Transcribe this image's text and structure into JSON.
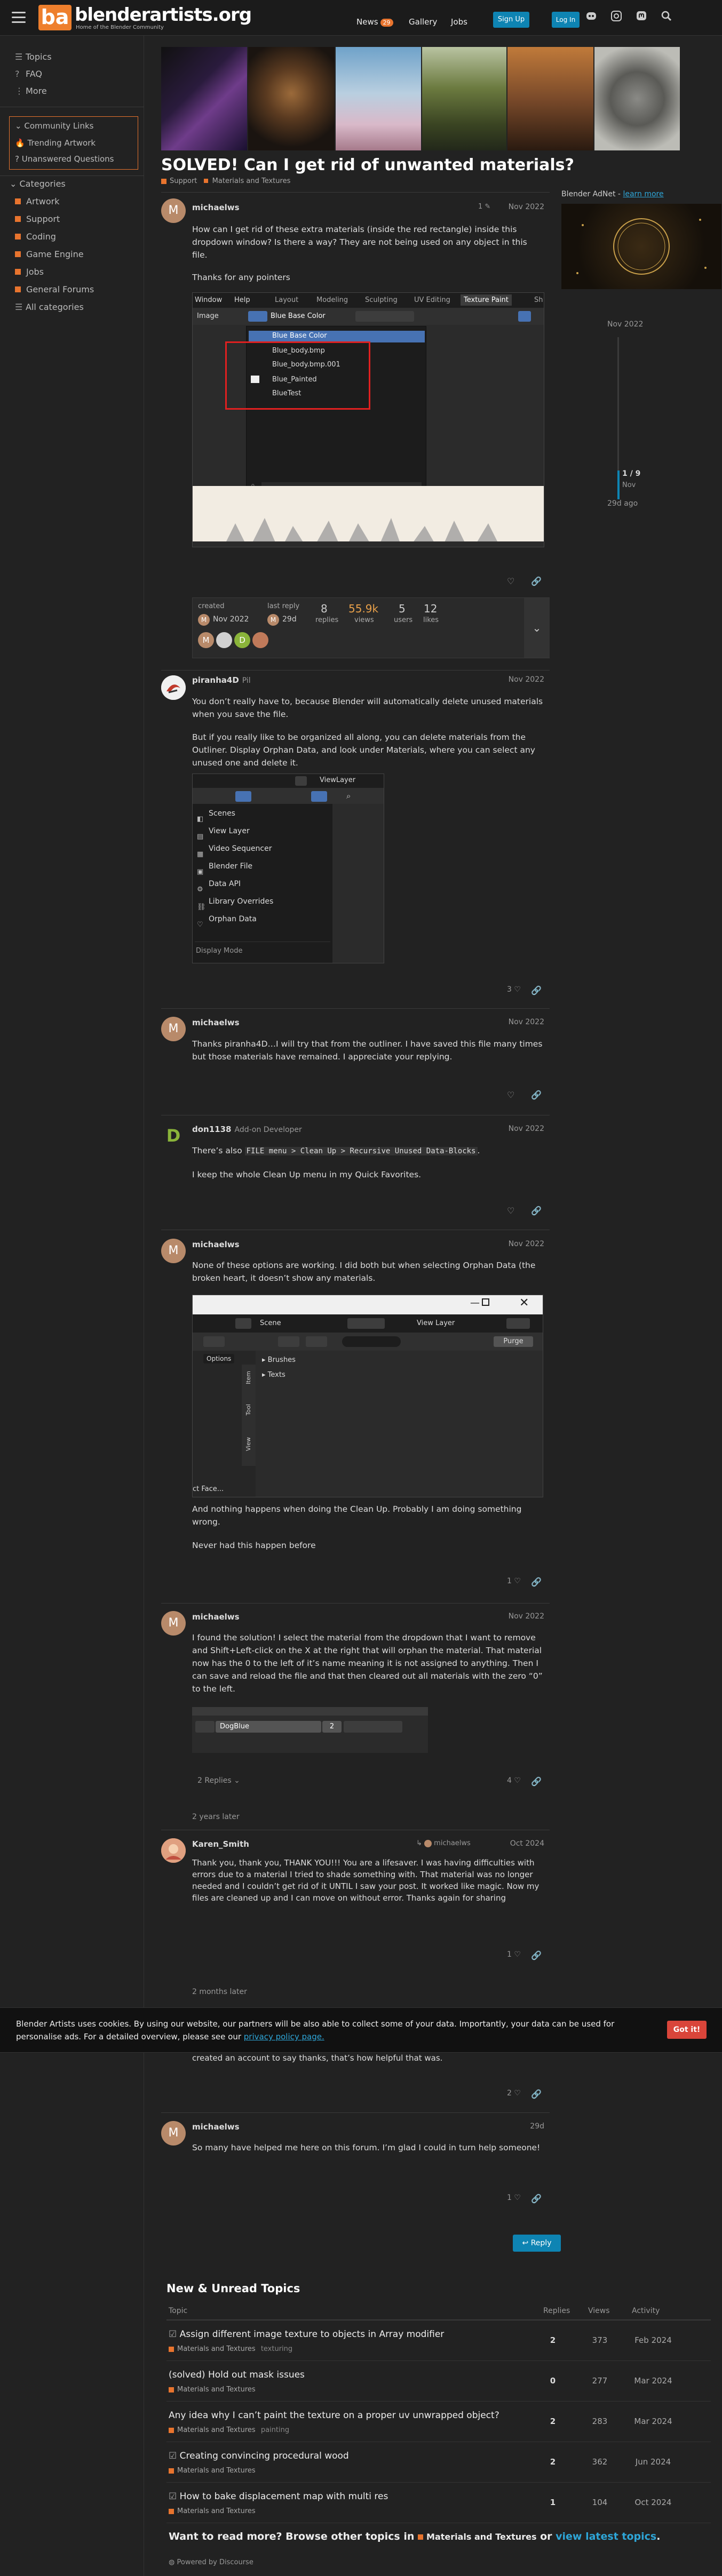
{
  "header": {
    "logo_letters": "ba",
    "logo_text": "blenderartists.org",
    "logo_sub": "Home of the Blender Community",
    "nav": {
      "news": "News",
      "news_badge": "29",
      "gallery": "Gallery",
      "jobs": "Jobs"
    },
    "signup": "Sign Up",
    "login": "Log In"
  },
  "sidebar": {
    "top": [
      "Topics",
      "FAQ",
      "More"
    ],
    "community": {
      "title": "Community Links",
      "items": [
        "Trending Artwork",
        "Unanswered Questions"
      ]
    },
    "categories_title": "Categories",
    "categories": [
      {
        "label": "Artwork",
        "color": "#e8742e"
      },
      {
        "label": "Support",
        "color": "#e8742e"
      },
      {
        "label": "Coding",
        "color": "#e8742e"
      },
      {
        "label": "Game Engine",
        "color": "#e8742e"
      },
      {
        "label": "Jobs",
        "color": "#e8742e"
      },
      {
        "label": "General Forums",
        "color": "#e8742e"
      }
    ],
    "all_categories": "All categories"
  },
  "topic": {
    "title": "SOLVED! Can I get rid of unwanted materials?",
    "crumb_parent": "Support",
    "crumb_child": "Materials and Textures"
  },
  "posts": [
    {
      "user": "michaelws",
      "date": "Nov 2022",
      "edit_count": "1",
      "p1": "How can I get rid of these extra materials (inside the red rectangle) inside this dropdown window? Is there a way? They are not being used on any object in this file.",
      "p2": "Thanks for any pointers"
    },
    {
      "user": "piranha4D",
      "user_title": "Pil",
      "date": "Nov 2022",
      "p1": "You don’t really have to, because Blender will automatically delete unused materials when you save the file.",
      "p2": "But if you really like to be organized all along, you can delete materials from the Outliner. Display Orphan Data, and look under Materials, where you can select any unused one and delete it.",
      "likes": "3"
    },
    {
      "user": "michaelws",
      "date": "Nov 2022",
      "p1": "Thanks piranha4D…I will try that from the outliner. I have saved this file many times but those materials have remained. I appreciate your replying."
    },
    {
      "user": "don1138",
      "user_title": "Add-on Developer",
      "date": "Nov 2022",
      "p1a": "There’s also ",
      "code": "FILE menu > Clean Up > Recursive Unused Data-Blocks",
      "p1b": ".",
      "p2": "I keep the whole Clean Up menu in my Quick Favorites."
    },
    {
      "user": "michaelws",
      "date": "Nov 2022",
      "p1": "None of these options are working. I did both but when selecting Orphan Data (the broken heart, it doesn’t show any materials.",
      "p2": "And nothing happens when doing the Clean Up. Probably I am doing something wrong.",
      "p3": "Never had this happen before",
      "likes": "1"
    },
    {
      "user": "michaelws",
      "date": "Nov 2022",
      "p1": "I found the solution! I select the material from the dropdown that I want to remove and Shift+Left-click on the X at the right that will orphan the material. That material now has the 0 to the left of it’s name meaning it is not assigned to anything. Then I can save and reload the file and that then cleared out all materials with the zero “0” to the left.",
      "likes": "4",
      "replies": "2 Replies"
    },
    {
      "user": "Karen_Smith",
      "reply_to": "michaelws",
      "date": "Oct 2024",
      "p1": "Thank you, thank you, THANK YOU!!! You are a lifesaver. I was having difficulties with errors due to a material I tried to shade something with. That material was no longer needed and I couldn’t get rid of it UNTIL I saw your post. It worked like magic. Now my files are cleaned up and I can move on without error. Thanks again for sharing",
      "likes": "1"
    },
    {
      "tail_text": "created an account to say thanks, that’s how helpful that was.",
      "likes": "2"
    },
    {
      "user": "michaelws",
      "date": "29d",
      "p1": "So many have helped me here on this forum. I’m glad I could in turn help someone!",
      "likes": "1"
    }
  ],
  "time_gaps": [
    "2 years later",
    "2 months later"
  ],
  "topic_map": {
    "created_lbl": "created",
    "created": "Nov 2022",
    "last_lbl": "last reply",
    "last": "29d",
    "replies": "8",
    "replies_lbl": "replies",
    "views": "55.9k",
    "views_lbl": "views",
    "users": "5",
    "users_lbl": "users",
    "likes": "12",
    "likes_lbl": "likes"
  },
  "screenshot1": {
    "menu": [
      "Window",
      "Help"
    ],
    "tabs": [
      "Layout",
      "Modeling",
      "Sculpting",
      "UV Editing",
      "Texture Paint",
      "Sh"
    ],
    "image_lbl": "Image",
    "field": "Blue Base Color",
    "items": [
      "Blue Base Color",
      "Blue_body.bmp",
      "Blue_body.bmp.001",
      "Blue_Painted",
      "BlueTest"
    ]
  },
  "screenshot2": {
    "header": "ViewLayer",
    "items": [
      "Scenes",
      "View Layer",
      "Video Sequencer",
      "Blender File",
      "Data API",
      "Library Overrides",
      "Orphan Data"
    ],
    "footer": "Display Mode"
  },
  "screenshot3": {
    "scene": "Scene",
    "view_layer": "View Layer",
    "options": "Options",
    "purge": "Purge",
    "tree": [
      "Brushes",
      "Texts"
    ],
    "vtabs": [
      "Item",
      "Tool",
      "View"
    ],
    "cut": "ct Face..."
  },
  "screenshot4": {
    "name": "DogBlue",
    "count": "2"
  },
  "right_rail": {
    "adnet": "Blender AdNet",
    "learn": "learn more",
    "timeline_top": "Nov 2022",
    "pos": "1 / 9",
    "pos_date": "Nov",
    "ago": "29d ago"
  },
  "reply_btn": "Reply",
  "suggested": {
    "title": "New & Unread Topics",
    "cols": [
      "Topic",
      "Replies",
      "Views",
      "Activity"
    ],
    "rows": [
      {
        "title": "Assign different image texture to objects in Array modifier",
        "cat": "Materials and Textures",
        "tag": "texturing",
        "replies": "2",
        "views": "373",
        "activity": "Feb 2024"
      },
      {
        "title": "(solved) Hold out mask issues",
        "cat": "Materials and Textures",
        "tag": "",
        "replies": "0",
        "views": "277",
        "activity": "Mar 2024"
      },
      {
        "title": "Any idea why I can’t paint the texture on a proper uv unwrapped object?",
        "cat": "Materials and Textures",
        "tag": "painting",
        "replies": "2",
        "views": "283",
        "activity": "Mar 2024"
      },
      {
        "title": "Creating convincing procedural wood",
        "cat": "Materials and Textures",
        "tag": "",
        "replies": "2",
        "views": "362",
        "activity": "Jun 2024"
      },
      {
        "title": "How to bake displacement map with multi res",
        "cat": "Materials and Textures",
        "tag": "",
        "replies": "1",
        "views": "104",
        "activity": "Oct 2024"
      }
    ],
    "more_a": "Want to read more? Browse other topics in ",
    "more_cat": "Materials and Textures",
    "more_or": " or ",
    "more_link": "view latest topics",
    "more_end": "."
  },
  "powered": "Powered by Discourse",
  "cookie": {
    "text": "Blender Artists uses cookies. By using our website, our partners will be also able to collect some of your data. Importantly, your data can be used for personalise ads. For a detailed overview, please see our ",
    "link": "privacy policy page.",
    "btn": "Got it!"
  },
  "colors": {
    "accent": "#e8742e",
    "link": "#2ea6d8",
    "bg": "#222222"
  }
}
